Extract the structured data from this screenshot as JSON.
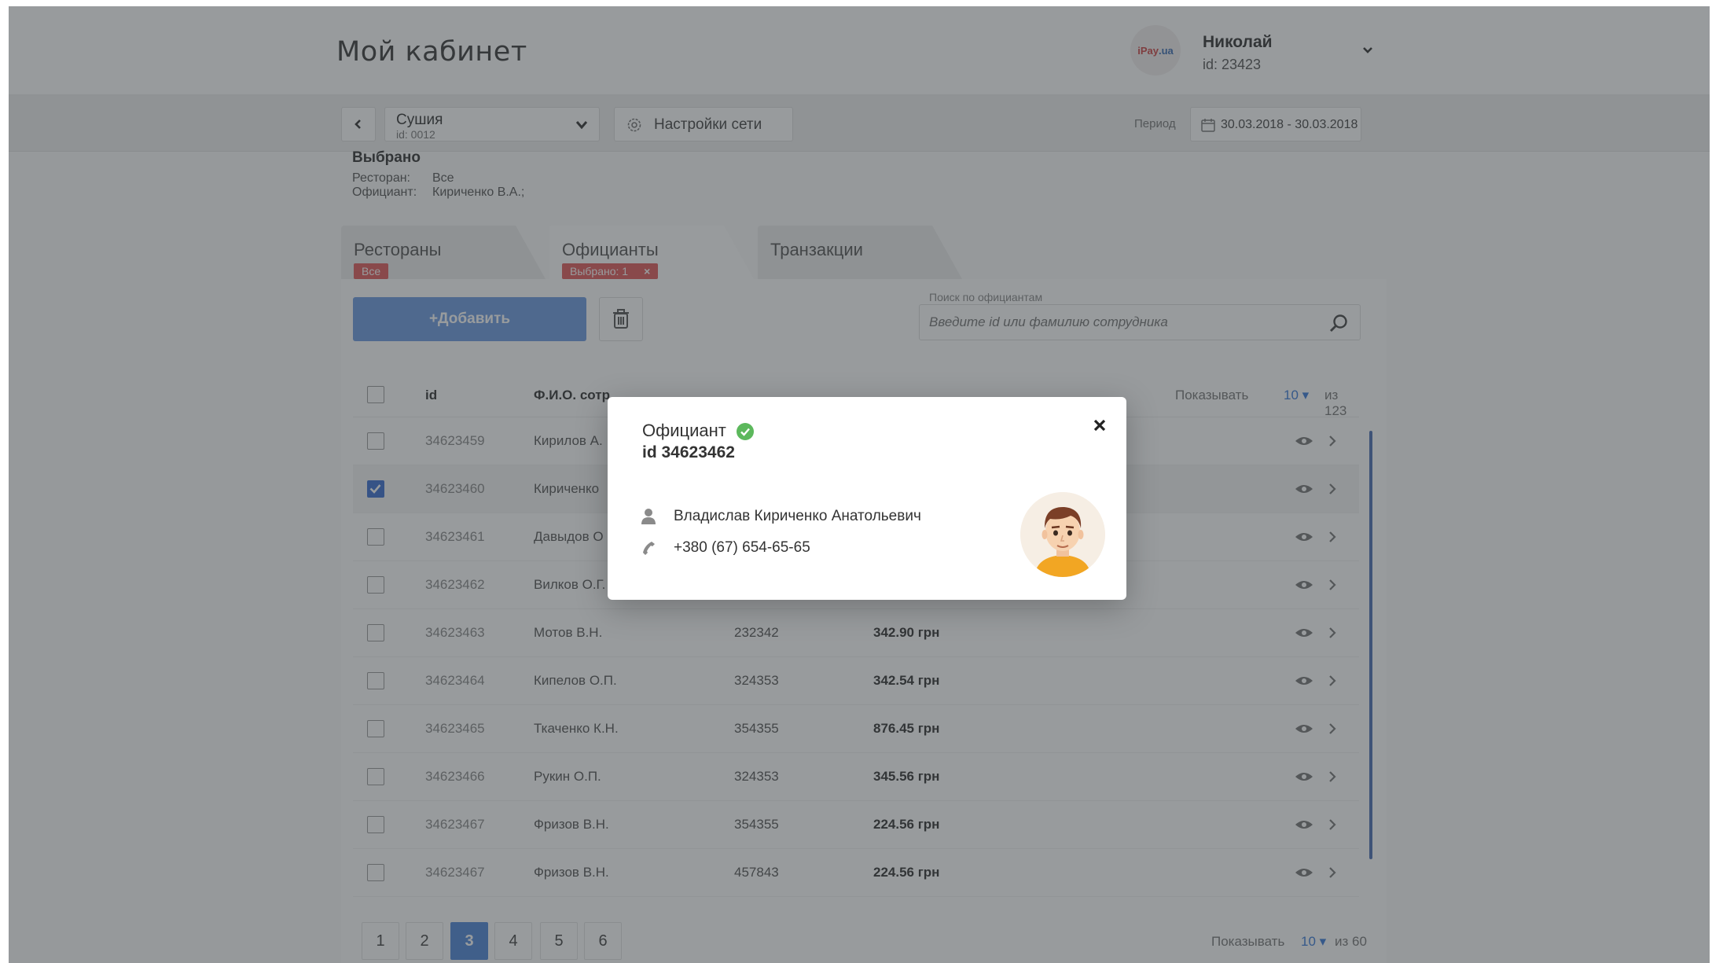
{
  "header": {
    "title": "Мой кабинет",
    "user": {
      "logo_text_left": "iPay",
      "logo_text_right": ".ua",
      "name": "Николай",
      "id_text": "id: 23423"
    }
  },
  "toolbar": {
    "network": {
      "name": "Сушия",
      "id_text": "id: 0012"
    },
    "settings_label": "Настройки сети",
    "period_label": "Период",
    "period_value": "30.03.2018 - 30.03.2018"
  },
  "selected": {
    "title": "Выбрано",
    "restaurant_key": "Ресторан:",
    "restaurant_value": "Все",
    "waiter_key": "Официант:",
    "waiter_value": "Кириченко В.А.;"
  },
  "tabs": {
    "restaurants": {
      "label": "Рестораны",
      "badge": "Все"
    },
    "waiters": {
      "label": "Официанты",
      "badge": "Выбрано: 1",
      "badge_close": "×"
    },
    "transactions": {
      "label": "Транзакции"
    }
  },
  "actions": {
    "add_label": "+Добавить",
    "search_label": "Поиск по официантам",
    "search_placeholder": "Введите id или фамилию сотрудника"
  },
  "table": {
    "headers": {
      "id": "id",
      "name": "Ф.И.О. сотр"
    },
    "show_label": "Показывать",
    "show_value": "10",
    "show_total": "из 123",
    "rows": [
      {
        "id": "34623459",
        "name": "Кирилов А.",
        "code": "",
        "sum": "",
        "checked": false
      },
      {
        "id": "34623460",
        "name": "Кириченко",
        "code": "",
        "sum": "",
        "checked": true
      },
      {
        "id": "34623461",
        "name": "Давыдов О",
        "code": "",
        "sum": "",
        "checked": false
      },
      {
        "id": "34623462",
        "name": "Вилков О.Г.",
        "code": "",
        "sum": "",
        "checked": false
      },
      {
        "id": "34623463",
        "name": "Мотов В.Н.",
        "code": "232342",
        "sum": "342.90 грн",
        "checked": false
      },
      {
        "id": "34623464",
        "name": "Кипелов О.П.",
        "code": "324353",
        "sum": "342.54 грн",
        "checked": false
      },
      {
        "id": "34623465",
        "name": "Ткаченко К.Н.",
        "code": "354355",
        "sum": "876.45 грн",
        "checked": false
      },
      {
        "id": "34623466",
        "name": "Рукин О.П.",
        "code": "324353",
        "sum": "345.56 грн",
        "checked": false
      },
      {
        "id": "34623467",
        "name": "Фризов В.Н.",
        "code": "354355",
        "sum": "224.56 грн",
        "checked": false
      },
      {
        "id": "34623467",
        "name": "Фризов В.Н.",
        "code": "457843",
        "sum": "224.56 грн",
        "checked": false
      }
    ]
  },
  "pagination": {
    "pages": [
      "1",
      "2",
      "3",
      "4",
      "5",
      "6"
    ],
    "active": "3",
    "show_label": "Показывать",
    "show_value": "10",
    "show_total": "из 60"
  },
  "modal": {
    "title": "Официант",
    "id_text": "id 34623462",
    "name": "Владислав Кириченко Анатольевич",
    "phone": "+380 (67) 654-65-65"
  },
  "colors": {
    "accent": "#4e86d9",
    "badge": "#e05a5a",
    "verified": "#5cb85c",
    "overlay": "rgba(50,55,60,0.5)"
  },
  "icons": [
    "chevron-down-icon",
    "chevron-left-icon",
    "gear-icon",
    "calendar-icon",
    "trash-icon",
    "search-icon",
    "eye-icon",
    "chevron-right-icon",
    "verified-icon",
    "close-icon",
    "person-icon",
    "phone-icon"
  ]
}
